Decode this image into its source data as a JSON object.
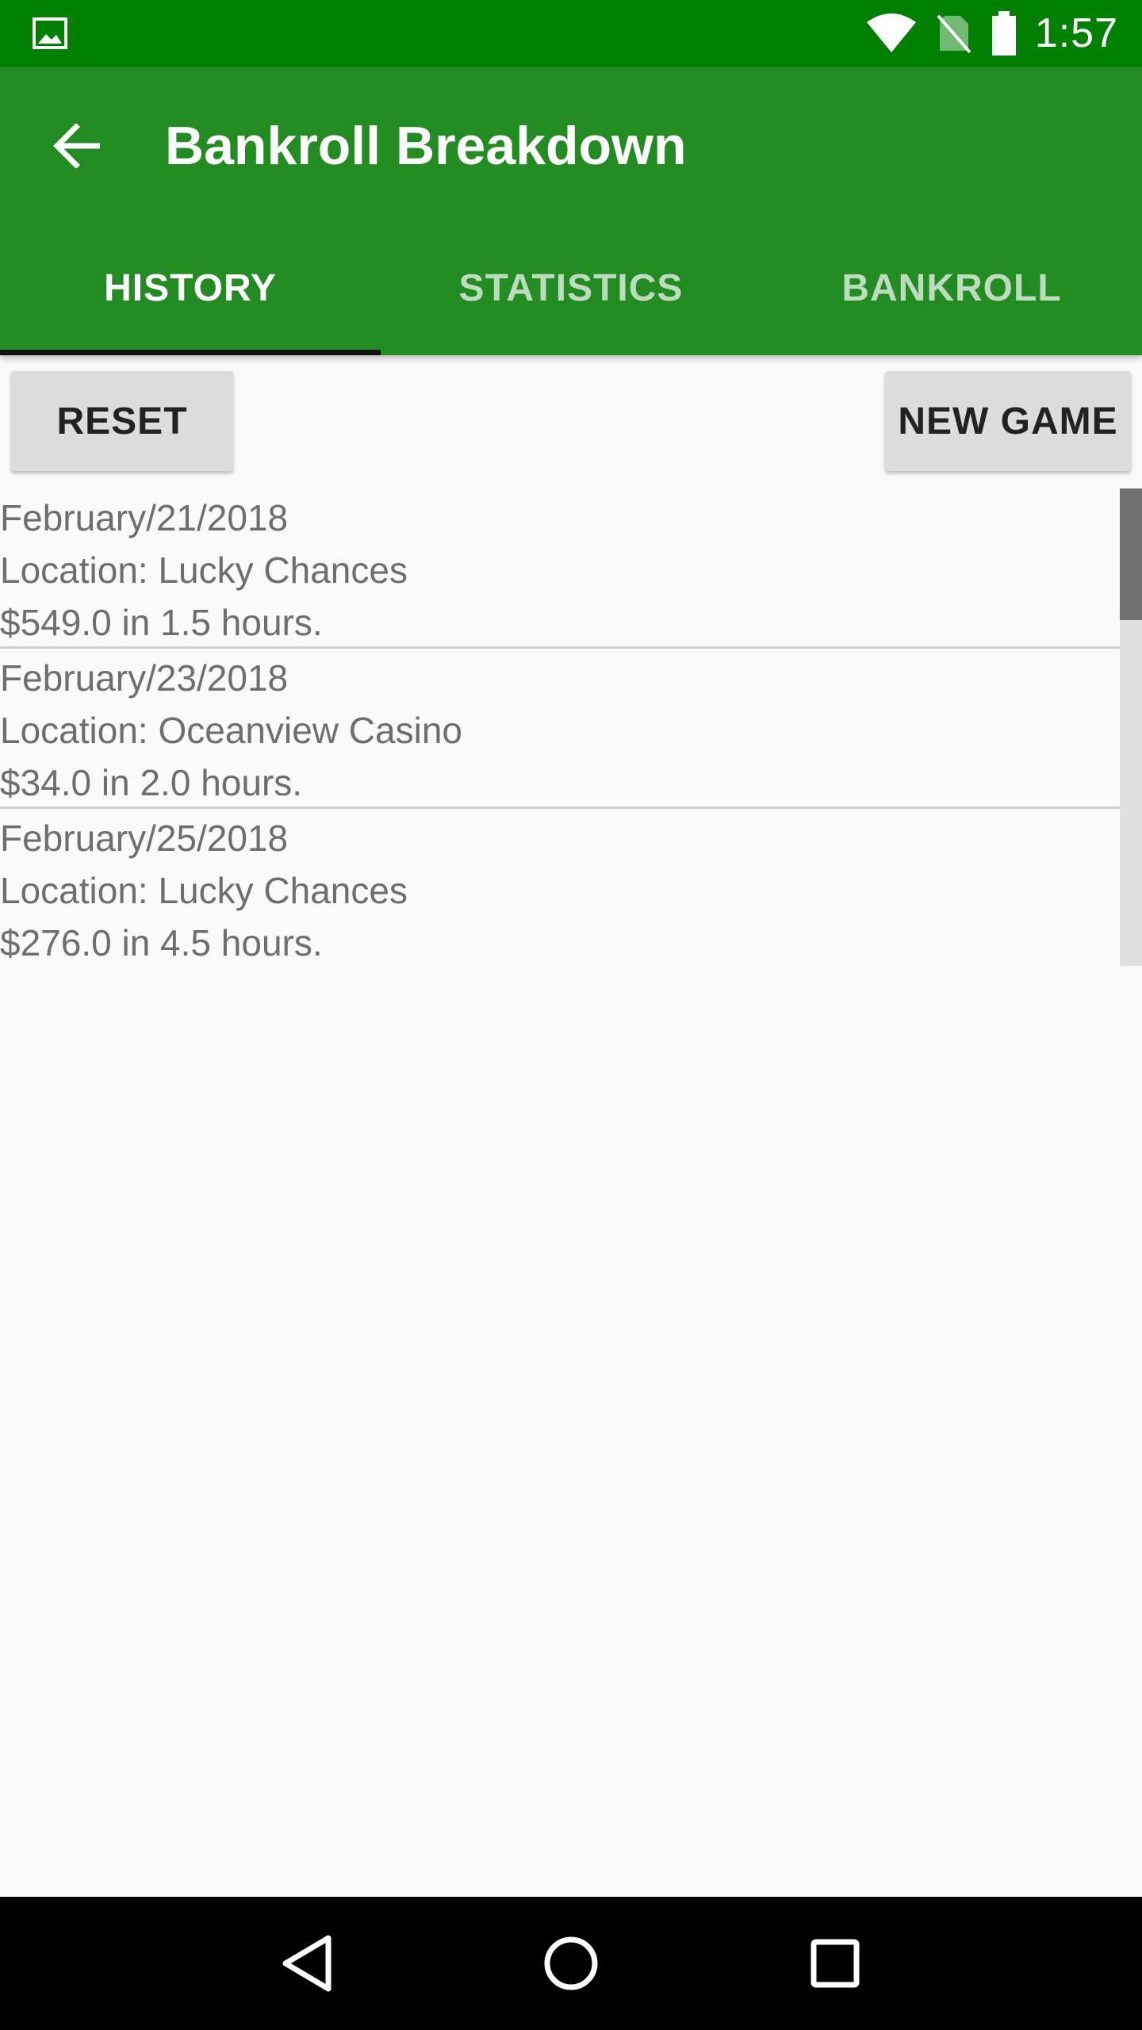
{
  "status_bar": {
    "time": "1:57",
    "icons": [
      "image-icon",
      "wifi-icon",
      "no-sim-icon",
      "battery-icon"
    ]
  },
  "app_bar": {
    "title": "Bankroll Breakdown",
    "back_icon": "arrow-left-icon",
    "color": "#228b22"
  },
  "tabs": [
    {
      "label": "HISTORY",
      "active": true
    },
    {
      "label": "STATISTICS",
      "active": false
    },
    {
      "label": "BANKROLL",
      "active": false
    }
  ],
  "actions": {
    "reset_label": "RESET",
    "new_game_label": "NEW GAME"
  },
  "history": [
    {
      "date": "February/21/2018",
      "location": "Location: Lucky Chances",
      "result": "$549.0 in 1.5 hours."
    },
    {
      "date": "February/23/2018",
      "location": "Location: Oceanview Casino",
      "result": "$34.0 in 2.0 hours."
    },
    {
      "date": "February/25/2018",
      "location": "Location: Lucky Chances",
      "result": "$276.0 in 4.5 hours."
    }
  ],
  "nav_bar": {
    "icons": [
      "back-triangle-icon",
      "home-circle-icon",
      "recents-square-icon"
    ]
  }
}
